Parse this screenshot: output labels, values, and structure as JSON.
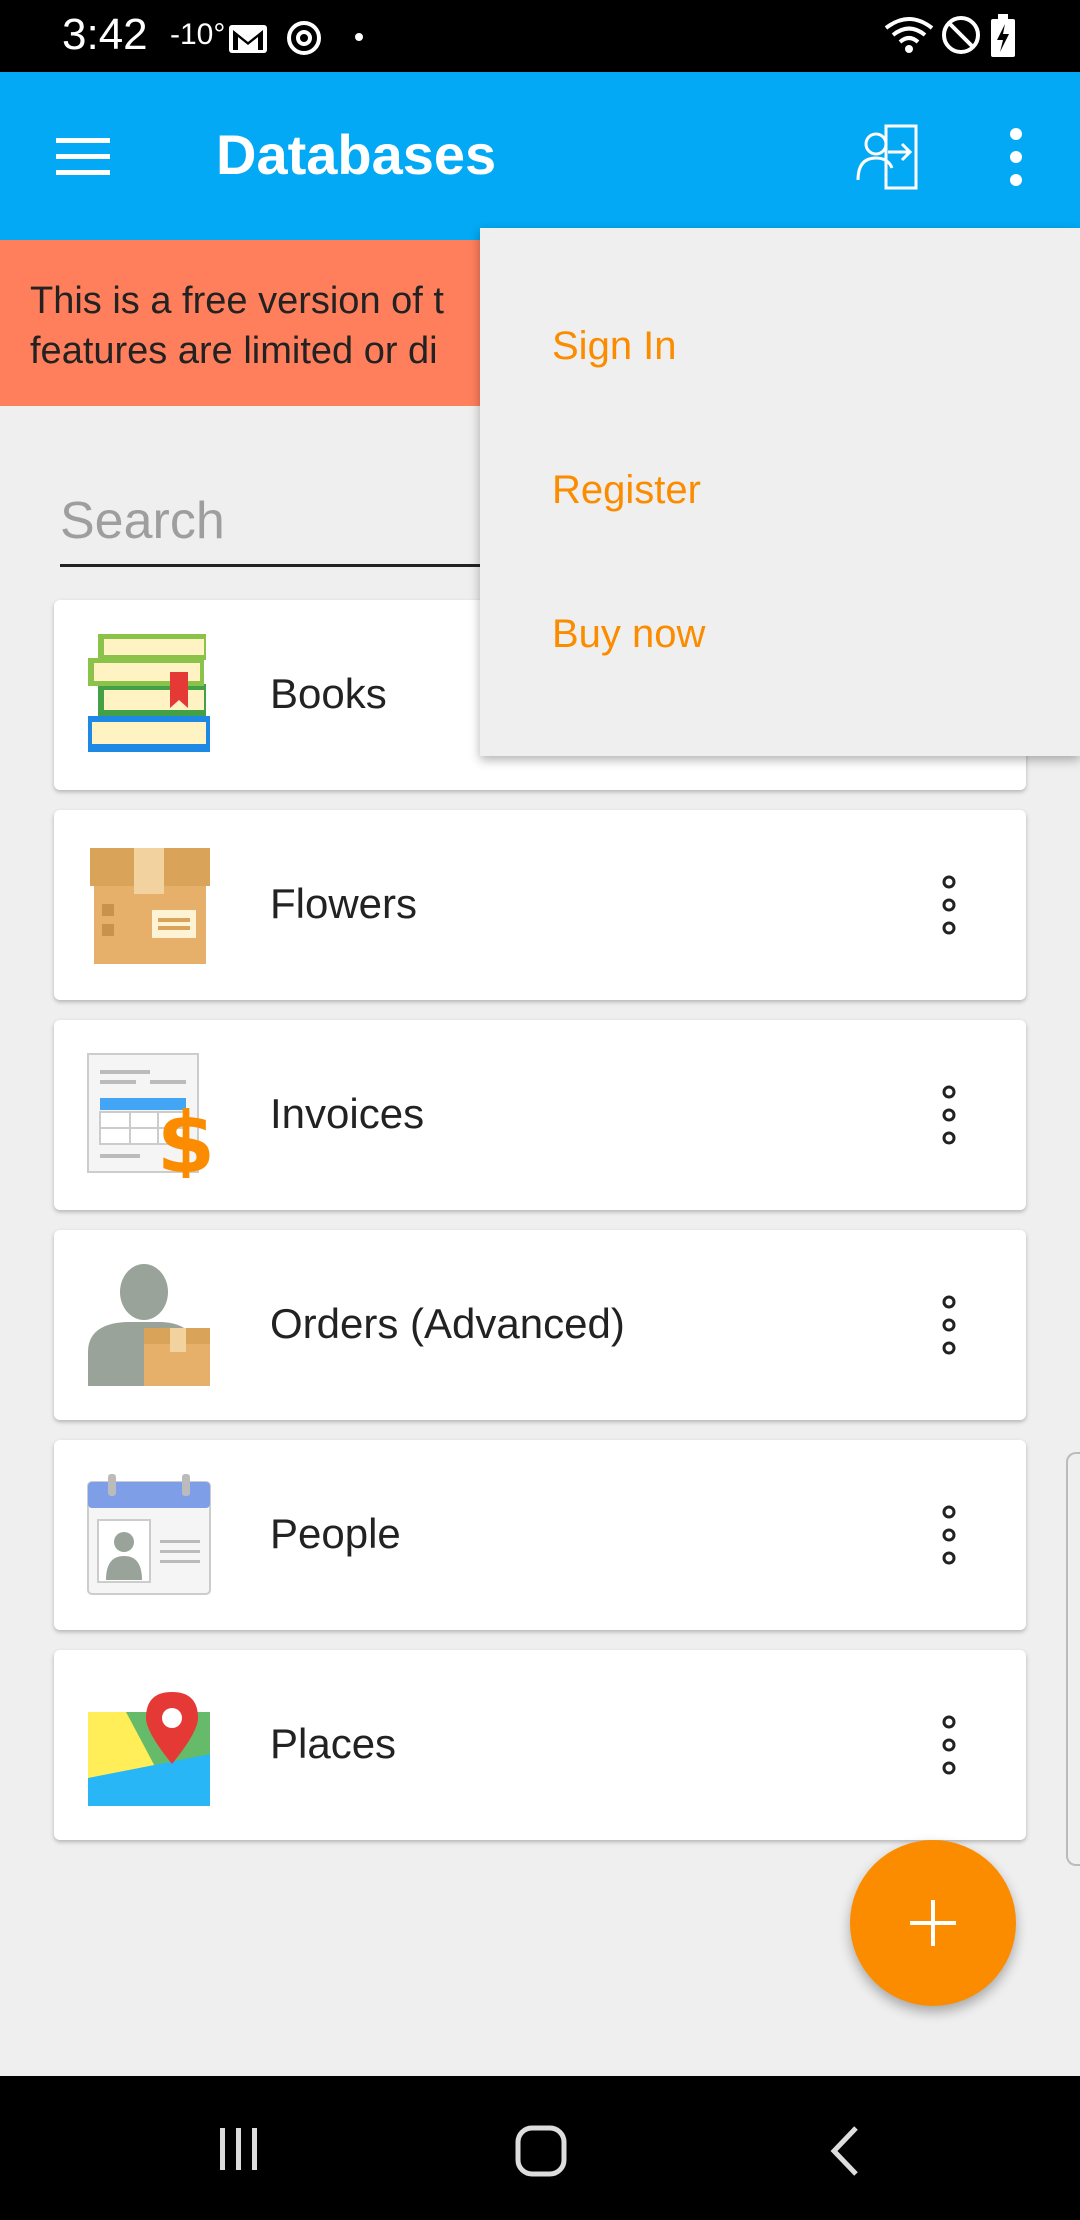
{
  "status_bar": {
    "time": "3:42",
    "temperature": "-10°",
    "icons": [
      "gmail-icon",
      "sync-icon",
      "dot-icon",
      "wifi-icon",
      "do-not-disturb-icon",
      "battery-charging-icon"
    ]
  },
  "app_bar": {
    "title": "Databases",
    "menu_icon": "hamburger-menu-icon",
    "login_icon": "sign-in-icon",
    "overflow_icon": "more-vertical-icon",
    "color": "#03a9f4"
  },
  "banner": {
    "line1": "This is a free version of t",
    "line2": "features are limited or di",
    "color": "#ff7f5c"
  },
  "search": {
    "placeholder": "Search"
  },
  "databases": [
    {
      "name": "Books",
      "icon": "books-icon"
    },
    {
      "name": "Flowers",
      "icon": "box-icon"
    },
    {
      "name": "Invoices",
      "icon": "invoice-icon"
    },
    {
      "name": "Orders (Advanced)",
      "icon": "person-box-icon"
    },
    {
      "name": "People",
      "icon": "contact-card-icon"
    },
    {
      "name": "Places",
      "icon": "map-icon"
    }
  ],
  "overflow_menu": {
    "items": [
      {
        "label": "Sign In"
      },
      {
        "label": "Register"
      },
      {
        "label": "Buy now"
      }
    ],
    "text_color": "#fb8c00"
  },
  "fab": {
    "icon": "plus-icon",
    "color": "#fb8c00"
  },
  "nav_bar": {
    "icons": [
      "recent-apps-icon",
      "home-icon",
      "back-icon"
    ]
  }
}
